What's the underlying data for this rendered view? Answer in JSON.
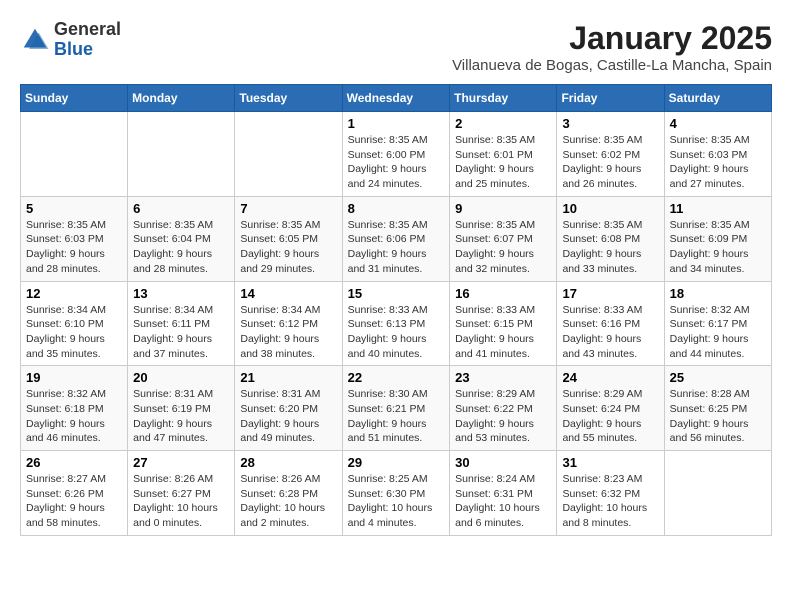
{
  "logo": {
    "general": "General",
    "blue": "Blue"
  },
  "header": {
    "month": "January 2025",
    "location": "Villanueva de Bogas, Castille-La Mancha, Spain"
  },
  "weekdays": [
    "Sunday",
    "Monday",
    "Tuesday",
    "Wednesday",
    "Thursday",
    "Friday",
    "Saturday"
  ],
  "weeks": [
    [
      {
        "day": "",
        "sunrise": "",
        "sunset": "",
        "daylight": ""
      },
      {
        "day": "",
        "sunrise": "",
        "sunset": "",
        "daylight": ""
      },
      {
        "day": "",
        "sunrise": "",
        "sunset": "",
        "daylight": ""
      },
      {
        "day": "1",
        "sunrise": "Sunrise: 8:35 AM",
        "sunset": "Sunset: 6:00 PM",
        "daylight": "Daylight: 9 hours and 24 minutes."
      },
      {
        "day": "2",
        "sunrise": "Sunrise: 8:35 AM",
        "sunset": "Sunset: 6:01 PM",
        "daylight": "Daylight: 9 hours and 25 minutes."
      },
      {
        "day": "3",
        "sunrise": "Sunrise: 8:35 AM",
        "sunset": "Sunset: 6:02 PM",
        "daylight": "Daylight: 9 hours and 26 minutes."
      },
      {
        "day": "4",
        "sunrise": "Sunrise: 8:35 AM",
        "sunset": "Sunset: 6:03 PM",
        "daylight": "Daylight: 9 hours and 27 minutes."
      }
    ],
    [
      {
        "day": "5",
        "sunrise": "Sunrise: 8:35 AM",
        "sunset": "Sunset: 6:03 PM",
        "daylight": "Daylight: 9 hours and 28 minutes."
      },
      {
        "day": "6",
        "sunrise": "Sunrise: 8:35 AM",
        "sunset": "Sunset: 6:04 PM",
        "daylight": "Daylight: 9 hours and 28 minutes."
      },
      {
        "day": "7",
        "sunrise": "Sunrise: 8:35 AM",
        "sunset": "Sunset: 6:05 PM",
        "daylight": "Daylight: 9 hours and 29 minutes."
      },
      {
        "day": "8",
        "sunrise": "Sunrise: 8:35 AM",
        "sunset": "Sunset: 6:06 PM",
        "daylight": "Daylight: 9 hours and 31 minutes."
      },
      {
        "day": "9",
        "sunrise": "Sunrise: 8:35 AM",
        "sunset": "Sunset: 6:07 PM",
        "daylight": "Daylight: 9 hours and 32 minutes."
      },
      {
        "day": "10",
        "sunrise": "Sunrise: 8:35 AM",
        "sunset": "Sunset: 6:08 PM",
        "daylight": "Daylight: 9 hours and 33 minutes."
      },
      {
        "day": "11",
        "sunrise": "Sunrise: 8:35 AM",
        "sunset": "Sunset: 6:09 PM",
        "daylight": "Daylight: 9 hours and 34 minutes."
      }
    ],
    [
      {
        "day": "12",
        "sunrise": "Sunrise: 8:34 AM",
        "sunset": "Sunset: 6:10 PM",
        "daylight": "Daylight: 9 hours and 35 minutes."
      },
      {
        "day": "13",
        "sunrise": "Sunrise: 8:34 AM",
        "sunset": "Sunset: 6:11 PM",
        "daylight": "Daylight: 9 hours and 37 minutes."
      },
      {
        "day": "14",
        "sunrise": "Sunrise: 8:34 AM",
        "sunset": "Sunset: 6:12 PM",
        "daylight": "Daylight: 9 hours and 38 minutes."
      },
      {
        "day": "15",
        "sunrise": "Sunrise: 8:33 AM",
        "sunset": "Sunset: 6:13 PM",
        "daylight": "Daylight: 9 hours and 40 minutes."
      },
      {
        "day": "16",
        "sunrise": "Sunrise: 8:33 AM",
        "sunset": "Sunset: 6:15 PM",
        "daylight": "Daylight: 9 hours and 41 minutes."
      },
      {
        "day": "17",
        "sunrise": "Sunrise: 8:33 AM",
        "sunset": "Sunset: 6:16 PM",
        "daylight": "Daylight: 9 hours and 43 minutes."
      },
      {
        "day": "18",
        "sunrise": "Sunrise: 8:32 AM",
        "sunset": "Sunset: 6:17 PM",
        "daylight": "Daylight: 9 hours and 44 minutes."
      }
    ],
    [
      {
        "day": "19",
        "sunrise": "Sunrise: 8:32 AM",
        "sunset": "Sunset: 6:18 PM",
        "daylight": "Daylight: 9 hours and 46 minutes."
      },
      {
        "day": "20",
        "sunrise": "Sunrise: 8:31 AM",
        "sunset": "Sunset: 6:19 PM",
        "daylight": "Daylight: 9 hours and 47 minutes."
      },
      {
        "day": "21",
        "sunrise": "Sunrise: 8:31 AM",
        "sunset": "Sunset: 6:20 PM",
        "daylight": "Daylight: 9 hours and 49 minutes."
      },
      {
        "day": "22",
        "sunrise": "Sunrise: 8:30 AM",
        "sunset": "Sunset: 6:21 PM",
        "daylight": "Daylight: 9 hours and 51 minutes."
      },
      {
        "day": "23",
        "sunrise": "Sunrise: 8:29 AM",
        "sunset": "Sunset: 6:22 PM",
        "daylight": "Daylight: 9 hours and 53 minutes."
      },
      {
        "day": "24",
        "sunrise": "Sunrise: 8:29 AM",
        "sunset": "Sunset: 6:24 PM",
        "daylight": "Daylight: 9 hours and 55 minutes."
      },
      {
        "day": "25",
        "sunrise": "Sunrise: 8:28 AM",
        "sunset": "Sunset: 6:25 PM",
        "daylight": "Daylight: 9 hours and 56 minutes."
      }
    ],
    [
      {
        "day": "26",
        "sunrise": "Sunrise: 8:27 AM",
        "sunset": "Sunset: 6:26 PM",
        "daylight": "Daylight: 9 hours and 58 minutes."
      },
      {
        "day": "27",
        "sunrise": "Sunrise: 8:26 AM",
        "sunset": "Sunset: 6:27 PM",
        "daylight": "Daylight: 10 hours and 0 minutes."
      },
      {
        "day": "28",
        "sunrise": "Sunrise: 8:26 AM",
        "sunset": "Sunset: 6:28 PM",
        "daylight": "Daylight: 10 hours and 2 minutes."
      },
      {
        "day": "29",
        "sunrise": "Sunrise: 8:25 AM",
        "sunset": "Sunset: 6:30 PM",
        "daylight": "Daylight: 10 hours and 4 minutes."
      },
      {
        "day": "30",
        "sunrise": "Sunrise: 8:24 AM",
        "sunset": "Sunset: 6:31 PM",
        "daylight": "Daylight: 10 hours and 6 minutes."
      },
      {
        "day": "31",
        "sunrise": "Sunrise: 8:23 AM",
        "sunset": "Sunset: 6:32 PM",
        "daylight": "Daylight: 10 hours and 8 minutes."
      },
      {
        "day": "",
        "sunrise": "",
        "sunset": "",
        "daylight": ""
      }
    ]
  ]
}
